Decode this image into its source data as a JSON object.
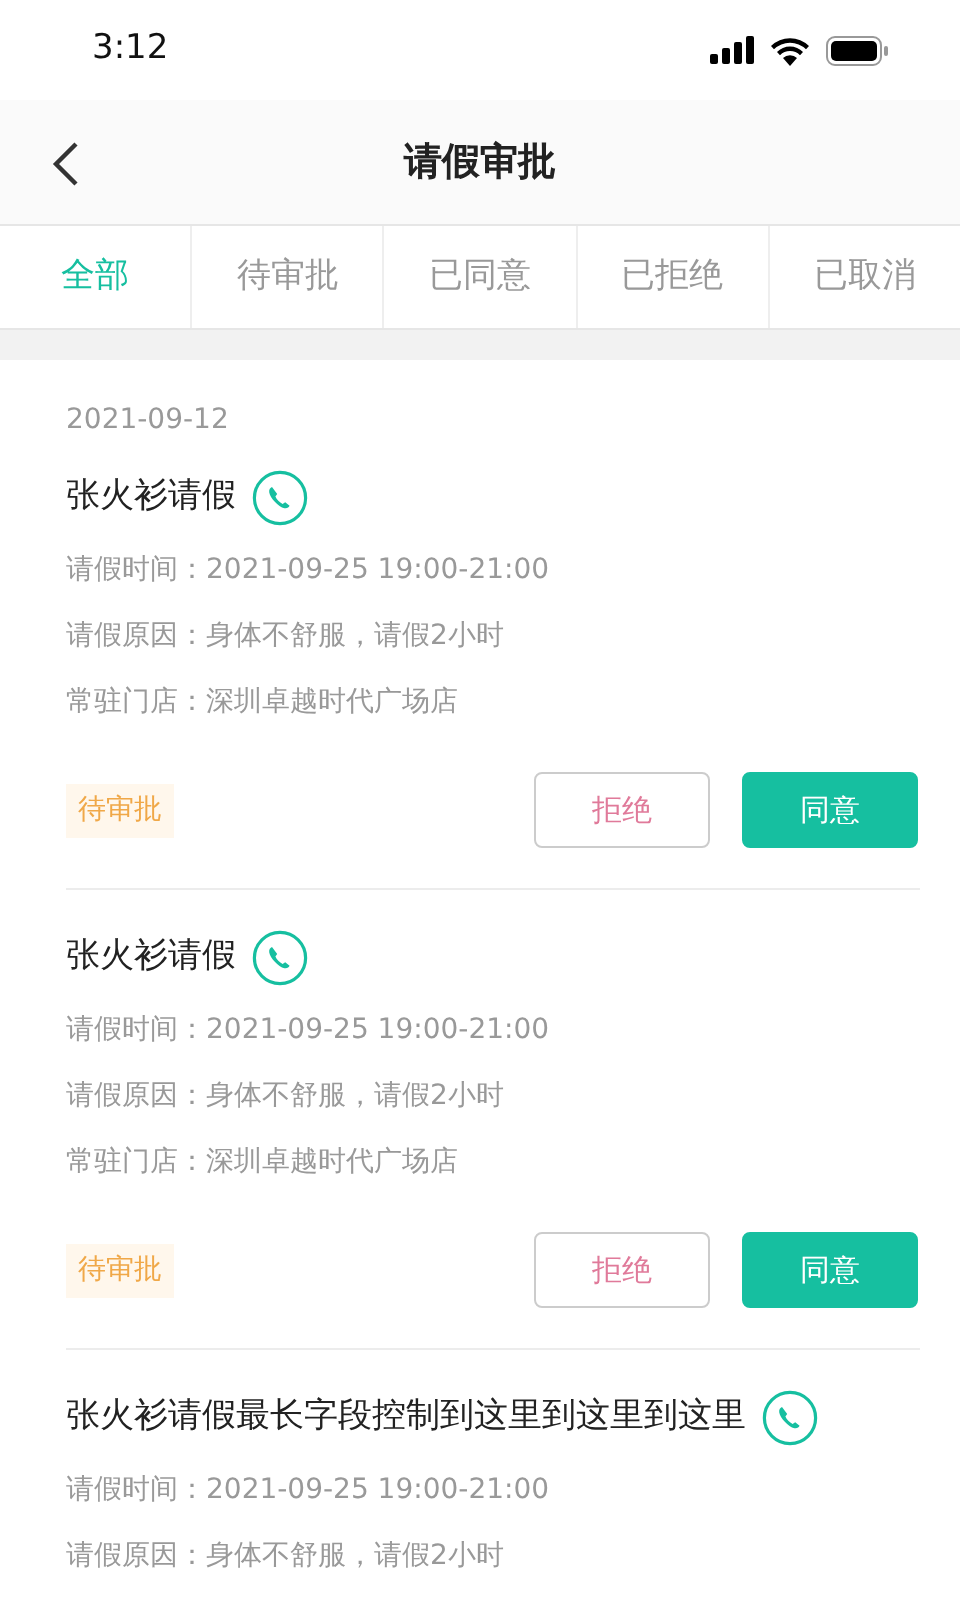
{
  "status_bar": {
    "time": "3:12"
  },
  "header": {
    "title": "请假审批"
  },
  "tabs": [
    {
      "label": "全部",
      "selected": true
    },
    {
      "label": "待审批",
      "selected": false
    },
    {
      "label": "已同意",
      "selected": false
    },
    {
      "label": "已拒绝",
      "selected": false
    },
    {
      "label": "已取消",
      "selected": false
    }
  ],
  "records": [
    {
      "date": "2021-09-12",
      "name": "张火衫请假",
      "lines": [
        "请假时间：2021-09-25 19:00-21:00",
        "请假原因：身体不舒服，请假2小时",
        "常驻门店：深圳卓越时代广场店"
      ],
      "status": "待审批",
      "actions": [
        {
          "label": "拒绝",
          "kind": "reject"
        },
        {
          "label": "同意",
          "kind": "approve"
        }
      ]
    },
    {
      "name": "张火衫请假",
      "lines": [
        "请假时间：2021-09-25 19:00-21:00",
        "请假原因：身体不舒服，请假2小时",
        "常驻门店：深圳卓越时代广场店"
      ],
      "status": "待审批",
      "actions": [
        {
          "label": "拒绝",
          "kind": "reject"
        },
        {
          "label": "同意",
          "kind": "approve"
        }
      ]
    },
    {
      "name": "张火衫请假最长字段控制到这里到这里到这里",
      "lines": [
        "请假时间：2021-09-25 19:00-21:00",
        "请假原因：身体不舒服，请假2小时"
      ]
    }
  ]
}
